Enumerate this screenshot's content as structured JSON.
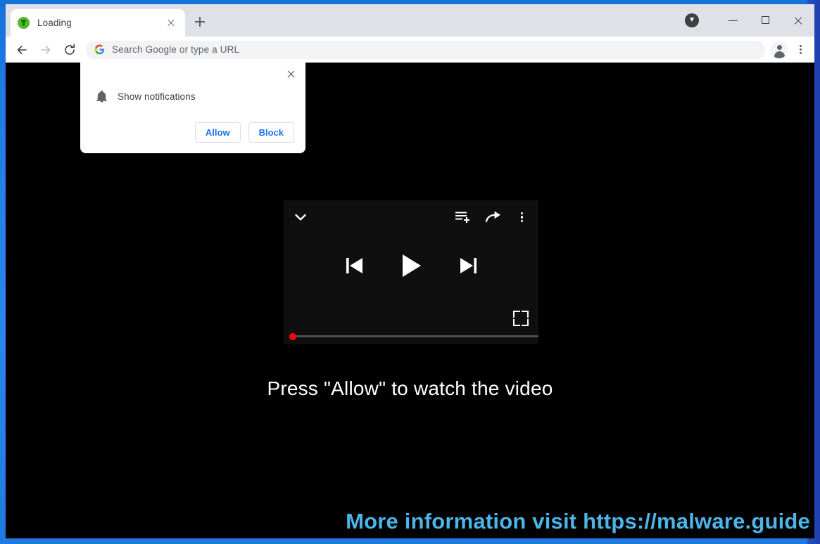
{
  "browser": {
    "tab": {
      "title": "Loading",
      "favicon_icon": "green-circle-favicon",
      "close_icon": "close-icon"
    },
    "new_tab_icon": "plus-icon",
    "window_controls": {
      "download_icon": "download-circle-icon",
      "minimize_icon": "minimize-icon",
      "maximize_icon": "maximize-icon",
      "close_icon": "close-icon"
    },
    "toolbar": {
      "back_icon": "arrow-left-icon",
      "forward_icon": "arrow-right-icon",
      "reload_icon": "reload-icon",
      "omnibox": {
        "search_engine_icon": "google-g-icon",
        "placeholder": "Search Google or type a URL",
        "value": ""
      },
      "profile_icon": "person-avatar-icon",
      "menu_icon": "three-dots-vertical-icon"
    }
  },
  "permission_bubble": {
    "close_icon": "close-icon",
    "bell_icon": "bell-icon",
    "label": "Show notifications",
    "allow_label": "Allow",
    "block_label": "Block"
  },
  "player": {
    "collapse_icon": "chevron-down-icon",
    "add_to_queue_icon": "add-to-queue-icon",
    "share_icon": "share-arrow-icon",
    "more_icon": "three-dots-vertical-icon",
    "previous_icon": "skip-previous-icon",
    "play_icon": "play-icon",
    "next_icon": "skip-next-icon",
    "fullscreen_icon": "fullscreen-icon",
    "progress_percent": 0,
    "progress_knob_color": "#ff0000"
  },
  "page": {
    "headline": "Press \"Allow\" to watch the video",
    "watermark": "More information visit https://malware.guide",
    "watermark_color": "#4db4e8",
    "background_color": "#000000"
  },
  "frame": {
    "accent_color": "#1f7ae0"
  }
}
